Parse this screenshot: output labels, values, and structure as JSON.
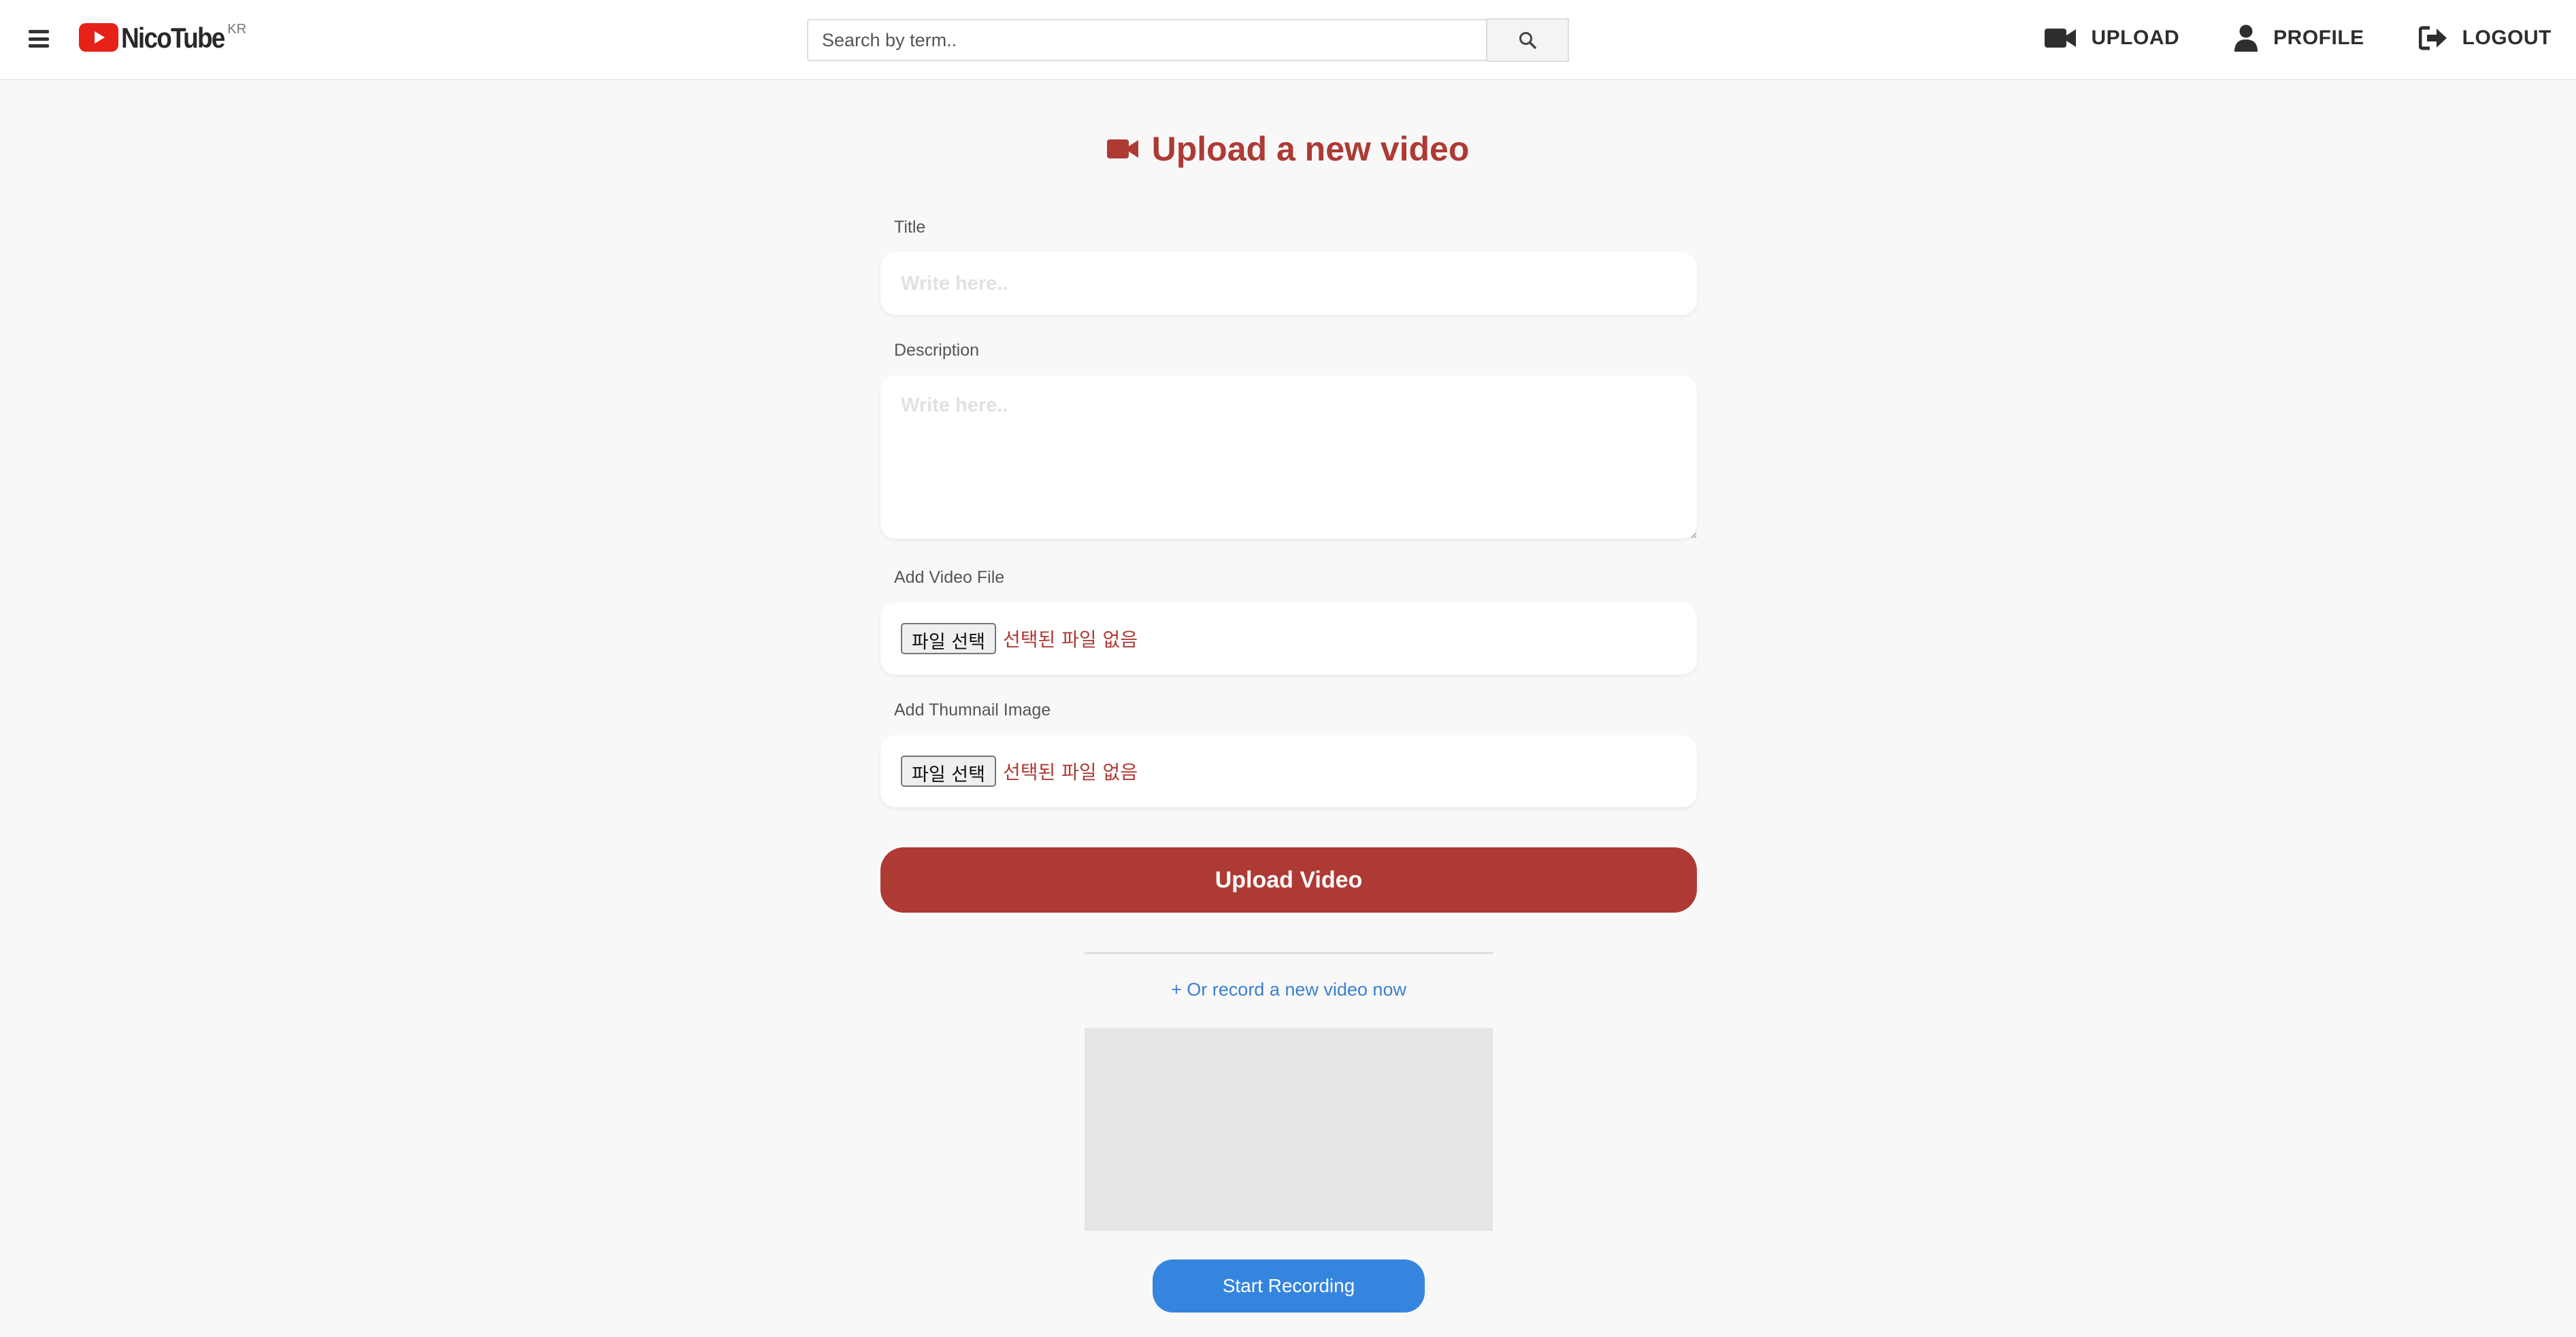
{
  "header": {
    "logo_text": "NicoTube",
    "logo_sup": "KR",
    "search_placeholder": "Search by term..",
    "nav": [
      {
        "label": "UPLOAD",
        "icon": "video-camera-icon"
      },
      {
        "label": "PROFILE",
        "icon": "user-icon"
      },
      {
        "label": "LOGOUT",
        "icon": "logout-icon"
      }
    ]
  },
  "main": {
    "title": "Upload a new video",
    "form": {
      "title_label": "Title",
      "title_placeholder": "Write here..",
      "description_label": "Description",
      "description_placeholder": "Write here..",
      "video_label": "Add Video File",
      "video_button": "파일 선택",
      "video_status": "선택된 파일 없음",
      "thumbnail_label": "Add Thumnail Image",
      "thumbnail_button": "파일 선택",
      "thumbnail_status": "선택된 파일 없음",
      "submit_label": "Upload Video"
    },
    "record": {
      "link_label": "+ Or record a new video now",
      "button_label": "Start Recording"
    }
  },
  "colors": {
    "brand_red": "#ae3a34",
    "logo_red": "#e62117",
    "link_blue": "#3b7fd0",
    "button_blue": "#3585df",
    "preview_gray": "#e5e5e5"
  }
}
